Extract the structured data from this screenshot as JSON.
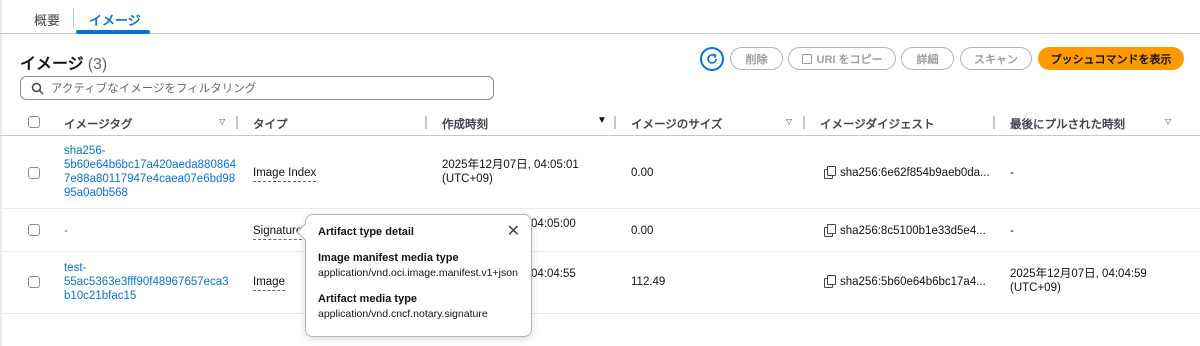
{
  "tabs": [
    {
      "label": "概要"
    },
    {
      "label": "イメージ"
    }
  ],
  "header": {
    "title": "イメージ",
    "count": "(3)"
  },
  "toolbar": {
    "refresh_icon": "refresh-icon",
    "delete_label": "削除",
    "copy_uri_label": "URI をコピー",
    "detail_label": "詳細",
    "scan_label": "スキャン",
    "push_label": "プッシュコマンドを表示",
    "accent_color": "#0972d3",
    "push_color": "#ff9900"
  },
  "search": {
    "placeholder": "アクティブなイメージをフィルタリング"
  },
  "table": {
    "columns": [
      {
        "label": "イメージタグ"
      },
      {
        "label": "タイプ"
      },
      {
        "label": "作成時刻"
      },
      {
        "label": "イメージのサイズ"
      },
      {
        "label": "イメージダイジェスト"
      },
      {
        "label": "最後にプルされた時刻"
      }
    ],
    "rows": [
      {
        "tag_lines": [
          "sha256-",
          "5b60e64b6bc17a420aeda880864",
          "7e88a80117947e4caea07e6bd98",
          "95a0a0b568"
        ],
        "type": "Image Index",
        "created_lines": [
          "2025年12月07日, 04:05:01",
          "(UTC+09)"
        ],
        "size": "0.00",
        "digest": "sha256:6e62f854b9aeb0da...",
        "last_pulled_lines": [
          "-"
        ]
      },
      {
        "tag_lines": [
          "-"
        ],
        "type": "Signature",
        "created_lines": [
          "04:05:00"
        ],
        "size": "0.00",
        "digest": "sha256:8c5100b1e33d5e4...",
        "last_pulled_lines": [
          "-"
        ]
      },
      {
        "tag_lines": [
          "test-",
          "55ac5363e3fff90f48967657eca3",
          "b10c21bfac15"
        ],
        "type": "Image",
        "created_lines": [
          "04:04:55"
        ],
        "size": "112.49",
        "digest": "sha256:5b60e64b6bc17a4...",
        "last_pulled_lines": [
          "2025年12月07日, 04:04:59",
          "(UTC+09)"
        ]
      }
    ]
  },
  "popover": {
    "title": "Artifact type detail",
    "manifest_label": "Image manifest media type",
    "manifest_value": "application/vnd.oci.image.manifest.v1+json",
    "artifact_label": "Artifact media type",
    "artifact_value": "application/vnd.cncf.notary.signature"
  }
}
